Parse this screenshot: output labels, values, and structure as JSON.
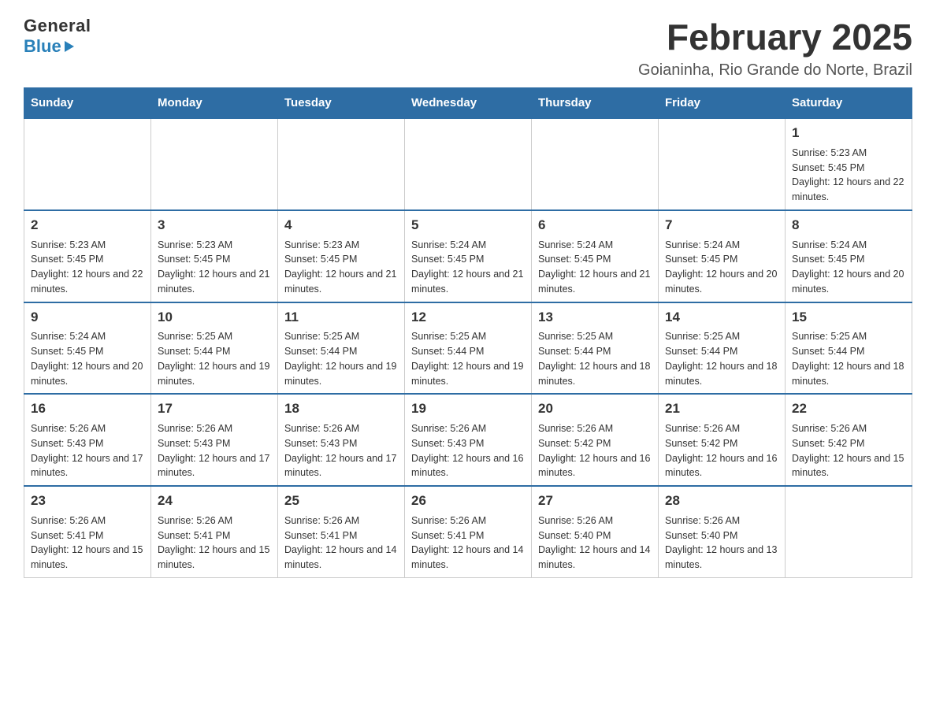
{
  "header": {
    "logo_line1": "General",
    "logo_line2": "Blue",
    "title": "February 2025",
    "subtitle": "Goianinha, Rio Grande do Norte, Brazil"
  },
  "days_of_week": [
    "Sunday",
    "Monday",
    "Tuesday",
    "Wednesday",
    "Thursday",
    "Friday",
    "Saturday"
  ],
  "weeks": [
    [
      {
        "day": "",
        "info": ""
      },
      {
        "day": "",
        "info": ""
      },
      {
        "day": "",
        "info": ""
      },
      {
        "day": "",
        "info": ""
      },
      {
        "day": "",
        "info": ""
      },
      {
        "day": "",
        "info": ""
      },
      {
        "day": "1",
        "info": "Sunrise: 5:23 AM\nSunset: 5:45 PM\nDaylight: 12 hours and 22 minutes."
      }
    ],
    [
      {
        "day": "2",
        "info": "Sunrise: 5:23 AM\nSunset: 5:45 PM\nDaylight: 12 hours and 22 minutes."
      },
      {
        "day": "3",
        "info": "Sunrise: 5:23 AM\nSunset: 5:45 PM\nDaylight: 12 hours and 21 minutes."
      },
      {
        "day": "4",
        "info": "Sunrise: 5:23 AM\nSunset: 5:45 PM\nDaylight: 12 hours and 21 minutes."
      },
      {
        "day": "5",
        "info": "Sunrise: 5:24 AM\nSunset: 5:45 PM\nDaylight: 12 hours and 21 minutes."
      },
      {
        "day": "6",
        "info": "Sunrise: 5:24 AM\nSunset: 5:45 PM\nDaylight: 12 hours and 21 minutes."
      },
      {
        "day": "7",
        "info": "Sunrise: 5:24 AM\nSunset: 5:45 PM\nDaylight: 12 hours and 20 minutes."
      },
      {
        "day": "8",
        "info": "Sunrise: 5:24 AM\nSunset: 5:45 PM\nDaylight: 12 hours and 20 minutes."
      }
    ],
    [
      {
        "day": "9",
        "info": "Sunrise: 5:24 AM\nSunset: 5:45 PM\nDaylight: 12 hours and 20 minutes."
      },
      {
        "day": "10",
        "info": "Sunrise: 5:25 AM\nSunset: 5:44 PM\nDaylight: 12 hours and 19 minutes."
      },
      {
        "day": "11",
        "info": "Sunrise: 5:25 AM\nSunset: 5:44 PM\nDaylight: 12 hours and 19 minutes."
      },
      {
        "day": "12",
        "info": "Sunrise: 5:25 AM\nSunset: 5:44 PM\nDaylight: 12 hours and 19 minutes."
      },
      {
        "day": "13",
        "info": "Sunrise: 5:25 AM\nSunset: 5:44 PM\nDaylight: 12 hours and 18 minutes."
      },
      {
        "day": "14",
        "info": "Sunrise: 5:25 AM\nSunset: 5:44 PM\nDaylight: 12 hours and 18 minutes."
      },
      {
        "day": "15",
        "info": "Sunrise: 5:25 AM\nSunset: 5:44 PM\nDaylight: 12 hours and 18 minutes."
      }
    ],
    [
      {
        "day": "16",
        "info": "Sunrise: 5:26 AM\nSunset: 5:43 PM\nDaylight: 12 hours and 17 minutes."
      },
      {
        "day": "17",
        "info": "Sunrise: 5:26 AM\nSunset: 5:43 PM\nDaylight: 12 hours and 17 minutes."
      },
      {
        "day": "18",
        "info": "Sunrise: 5:26 AM\nSunset: 5:43 PM\nDaylight: 12 hours and 17 minutes."
      },
      {
        "day": "19",
        "info": "Sunrise: 5:26 AM\nSunset: 5:43 PM\nDaylight: 12 hours and 16 minutes."
      },
      {
        "day": "20",
        "info": "Sunrise: 5:26 AM\nSunset: 5:42 PM\nDaylight: 12 hours and 16 minutes."
      },
      {
        "day": "21",
        "info": "Sunrise: 5:26 AM\nSunset: 5:42 PM\nDaylight: 12 hours and 16 minutes."
      },
      {
        "day": "22",
        "info": "Sunrise: 5:26 AM\nSunset: 5:42 PM\nDaylight: 12 hours and 15 minutes."
      }
    ],
    [
      {
        "day": "23",
        "info": "Sunrise: 5:26 AM\nSunset: 5:41 PM\nDaylight: 12 hours and 15 minutes."
      },
      {
        "day": "24",
        "info": "Sunrise: 5:26 AM\nSunset: 5:41 PM\nDaylight: 12 hours and 15 minutes."
      },
      {
        "day": "25",
        "info": "Sunrise: 5:26 AM\nSunset: 5:41 PM\nDaylight: 12 hours and 14 minutes."
      },
      {
        "day": "26",
        "info": "Sunrise: 5:26 AM\nSunset: 5:41 PM\nDaylight: 12 hours and 14 minutes."
      },
      {
        "day": "27",
        "info": "Sunrise: 5:26 AM\nSunset: 5:40 PM\nDaylight: 12 hours and 14 minutes."
      },
      {
        "day": "28",
        "info": "Sunrise: 5:26 AM\nSunset: 5:40 PM\nDaylight: 12 hours and 13 minutes."
      },
      {
        "day": "",
        "info": ""
      }
    ]
  ]
}
